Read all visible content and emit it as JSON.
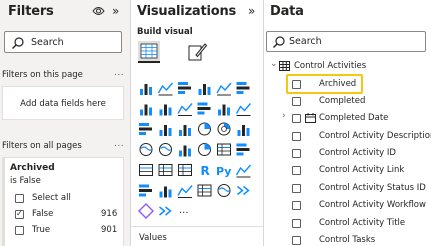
{
  "filters": {
    "title": "Filters",
    "search_placeholder": "Search",
    "on_page_label": "Filters on this page",
    "add_fields_label": "Add data fields here",
    "on_all_pages_label": "Filters on all pages",
    "more_label": "...",
    "card": {
      "field": "Archived",
      "condition": "is False",
      "options": [
        {
          "label": "Select all",
          "count": "",
          "checked": false
        },
        {
          "label": "False",
          "count": "916",
          "checked": true
        },
        {
          "label": "True",
          "count": "901",
          "checked": false
        }
      ]
    }
  },
  "viz": {
    "title": "Visualizations",
    "build_label": "Build visual",
    "values_label": "Values",
    "more_visuals": "...",
    "text_glyphs": {
      "r": "R",
      "py": "Py"
    }
  },
  "data": {
    "title": "Data",
    "search_placeholder": "Search",
    "table_name": "Control Activities",
    "fields": [
      "Archived",
      "Completed",
      "Completed Date",
      "Control Activity Description",
      "Control Activity ID",
      "Control Activity Link",
      "Control Activity Status ID",
      "Control Activity Workflow",
      "Control Activity Title",
      "Control Tasks"
    ]
  },
  "colors": {
    "highlight": "#f2c811",
    "accent": "#118dff",
    "pane_bg": "#f3f2f1"
  }
}
